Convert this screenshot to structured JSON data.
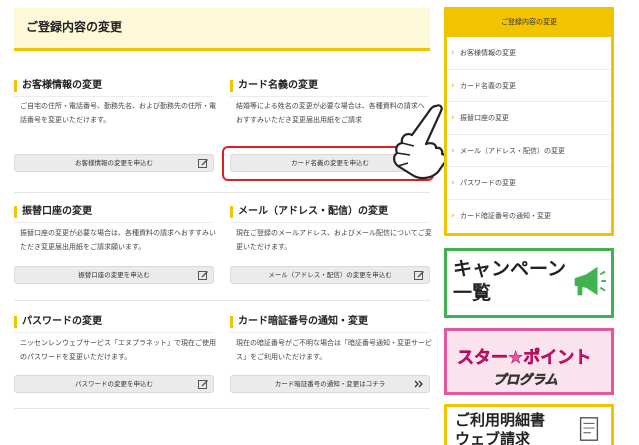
{
  "main": {
    "title": "ご登録内容の変更",
    "sections": [
      {
        "title": "お客様情報の変更",
        "description": "ご自宅の住所・電話番号、勤務先名、および勤務先の住所・電話番号を変更いただけます。",
        "button": "お客様情報の変更を申込む",
        "button_icon": "edit-icon"
      },
      {
        "title": "カード名義の変更",
        "description": "結婚等による姓名の変更が必要な場合は、各種資料の請求へおすすみいただき変更届出用紙をご請求",
        "button": "カード名義の変更を申込む",
        "button_icon": "edit-icon"
      },
      {
        "title": "振替口座の変更",
        "description": "振替口座の変更が必要な場合は、各種資料の請求へおすすみいただき変更届出用紙をご請求願います。",
        "button": "振替口座の変更を申込む",
        "button_icon": "edit-icon"
      },
      {
        "title": "メール（アドレス・配信）の変更",
        "description": "現在ご登録のメールアドレス、およびメール配信についてご変更いただけます。",
        "button": "メール（アドレス・配信）の変更を申込む",
        "button_icon": "edit-icon"
      },
      {
        "title": "パスワードの変更",
        "description": "ニッセンレンウェブサービス「エヌプラネット」で現在ご使用のパスワードを変更いただけます。",
        "button": "パスワードの変更を申込む",
        "button_icon": "edit-icon"
      },
      {
        "title": "カード暗証番号の通知・変更",
        "description": "現在の暗証番号がご不明な場合は「暗証番号通知・変更サービス」をご利用いただけます。",
        "button": "カード暗証番号の通知・変更はコチラ",
        "button_icon": "double-chevron-right-icon"
      }
    ]
  },
  "sidebar": {
    "heading": "ご登録内容の変更",
    "items": [
      "お客様情報の変更",
      "カード名義の変更",
      "振替口座の変更",
      "メール（アドレス・配信）の変更",
      "パスワードの変更",
      "カード暗証番号の通知・変更"
    ],
    "banners": {
      "campaign_line1": "キャンペーン",
      "campaign_line2": "一覧",
      "star_line1": "スター★ポイント",
      "star_line2": "プログラム",
      "bill_line1": "ご利用明細書",
      "bill_line2": "ウェブ請求"
    }
  },
  "colors": {
    "accent_yellow": "#f2c300",
    "highlight_red": "#e02020",
    "campaign_green": "#3fb34f",
    "star_pink": "#e8579b"
  }
}
